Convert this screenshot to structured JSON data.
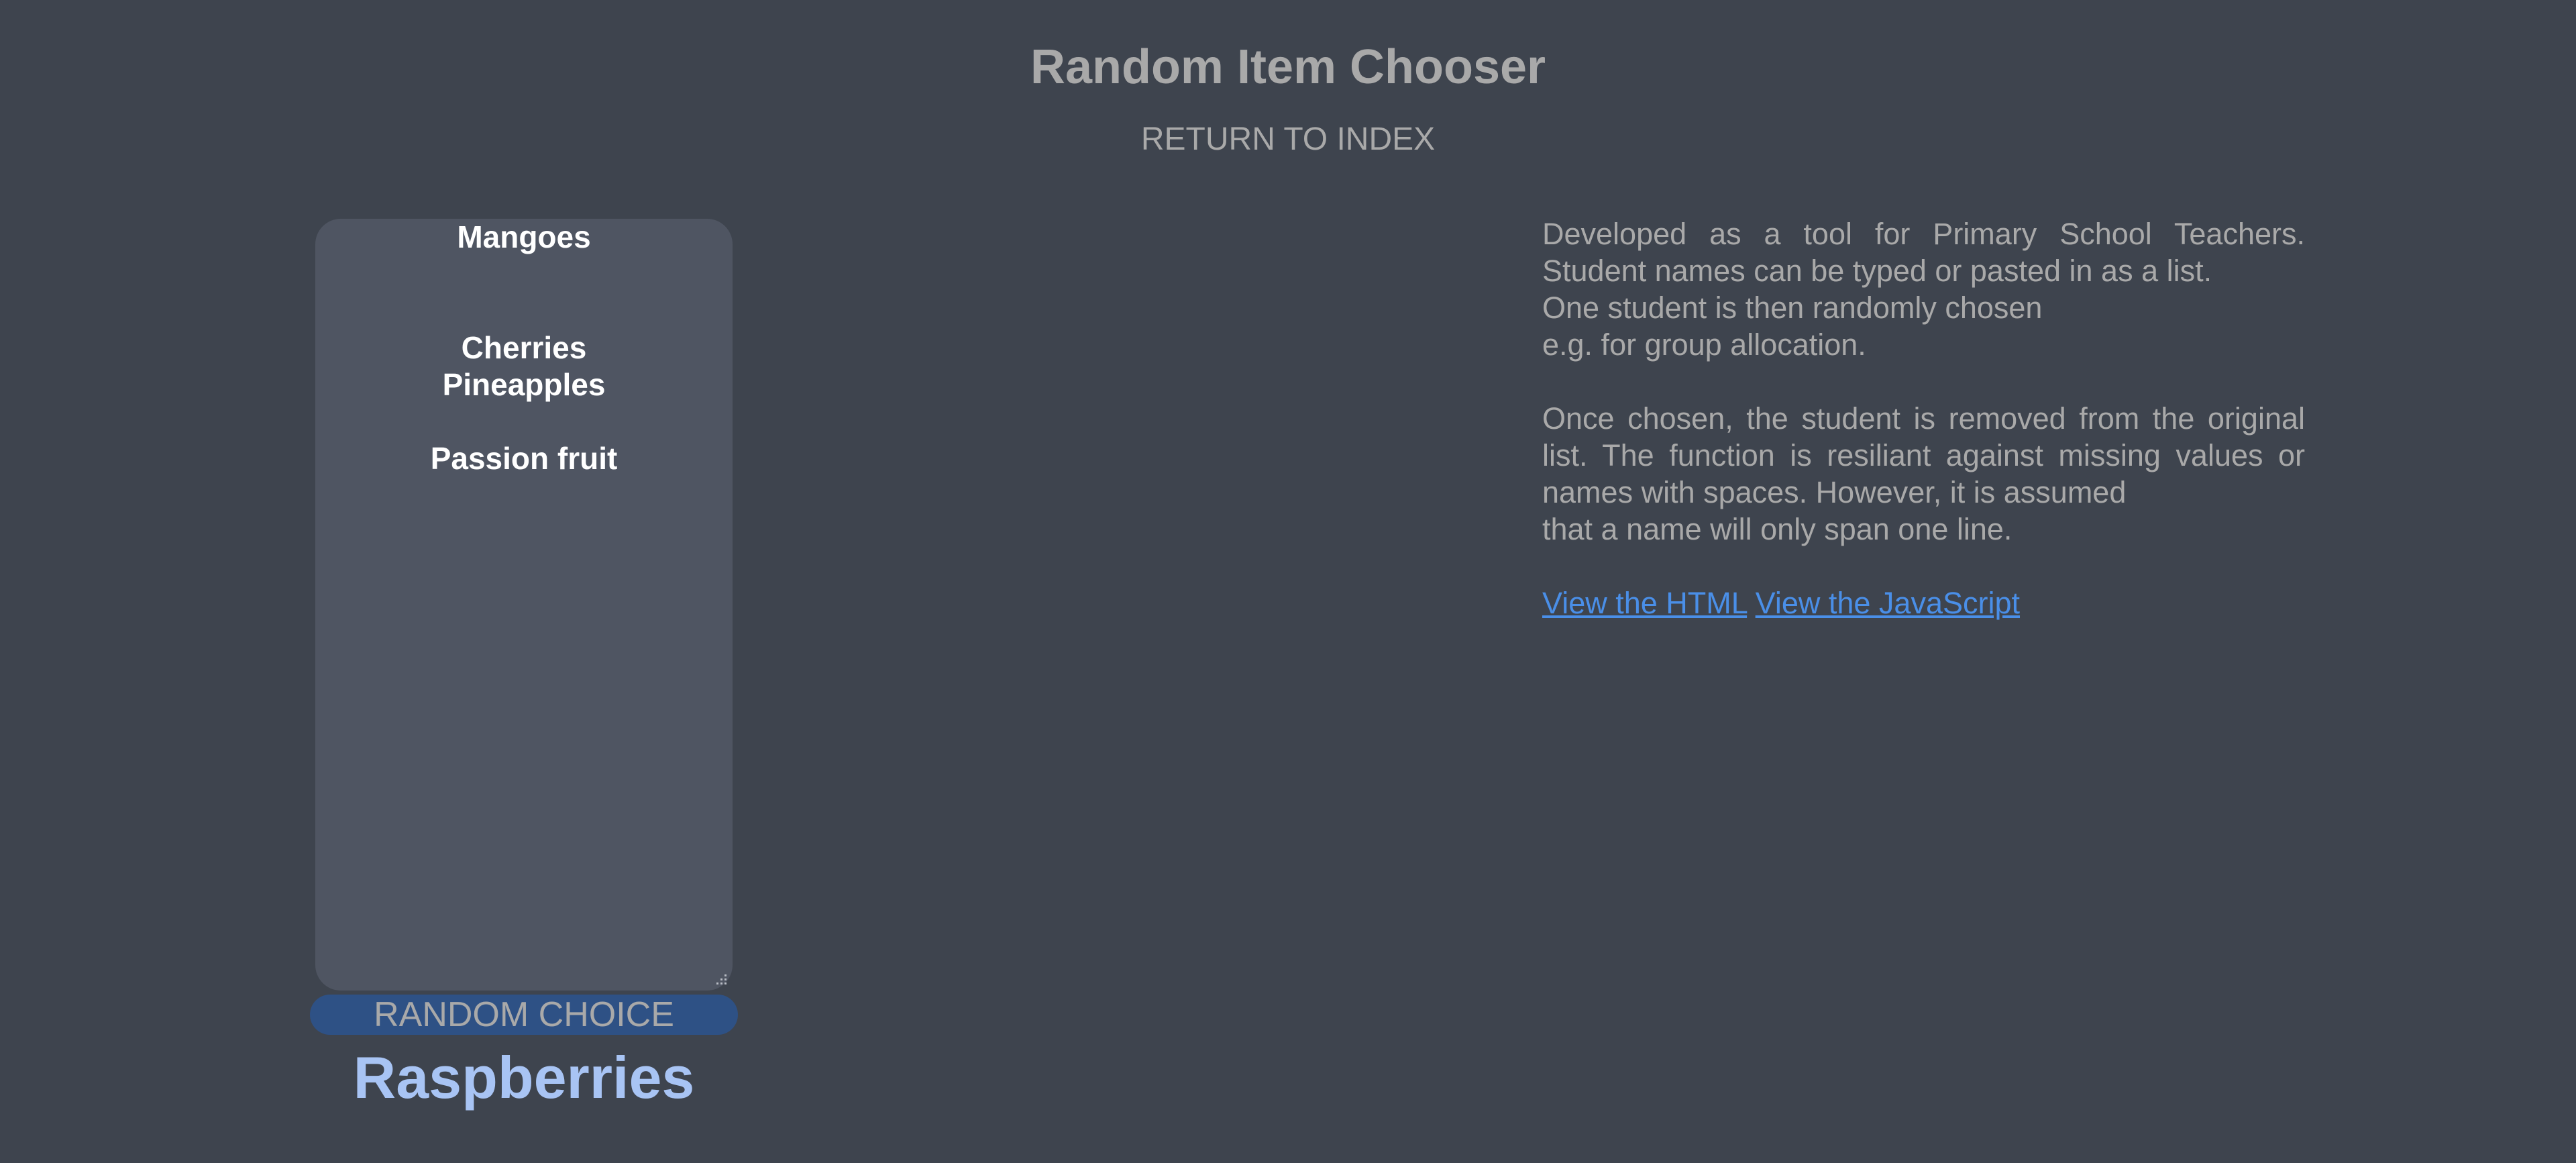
{
  "header": {
    "title": "Random Item Chooser",
    "return_link": "RETURN TO INDEX"
  },
  "chooser": {
    "list_lines": [
      "Mangoes",
      "",
      "",
      "Cherries",
      "Pineapples",
      "",
      "Passion fruit"
    ],
    "button_label": "RANDOM CHOICE",
    "result": "Raspberries"
  },
  "description": {
    "paragraph1_justified": "Developed as a tool for Primary School Teachers. Student names can be typed or pasted in as a list.",
    "paragraph1_line3": "One student is then randomly chosen",
    "paragraph1_line4": "e.g. for group allocation.",
    "paragraph2_justified": "Once chosen, the student is removed from the original list. The function is resiliant against missing values or names with spaces. However, it is assumed",
    "paragraph2_last": "that a name will only span one line.",
    "link_html": "View the HTML",
    "link_js": "View the JavaScript"
  },
  "colors": {
    "background": "#3e444e",
    "textarea_bg": "#4f5562",
    "button_bg": "#2e5185",
    "result_text": "#a8c4f4",
    "link": "#4a8fe8",
    "muted_text": "#a9a9a9"
  }
}
